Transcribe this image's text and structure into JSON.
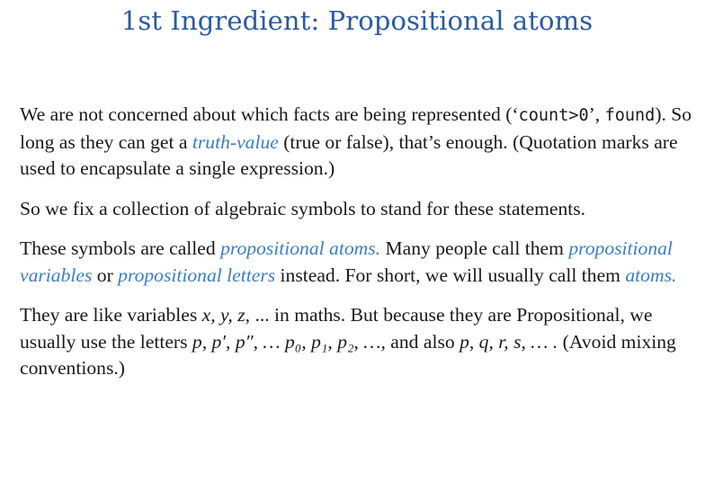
{
  "title": "1st Ingredient: Propositional atoms",
  "p1": {
    "a": "We are not concerned about which facts are being represented (‘",
    "code1": "count>0",
    "b": "’, ",
    "code2": "found",
    "c": "). So long as they can get a ",
    "em": "truth-value",
    "d": " (true or false), that’s enough. (Quotation marks are used to encapsulate a single expression.)"
  },
  "p2": {
    "text": "So we fix a collection of algebraic symbols to stand for these statements."
  },
  "p3": {
    "a": "These symbols are called ",
    "em1": "propositional atoms.",
    "b": " Many people call them ",
    "em2": "propositional variables",
    "c": " or ",
    "em3": "propositional letters",
    "d": " instead. For short, we will usually call them ",
    "em4": "atoms."
  },
  "p4": {
    "a": "They are like variables ",
    "m1": "x, y, z",
    "b": ", ... in maths. But because they are Propositional, we usually use the letters ",
    "m2": "p, p′, p″, … p₀, p₁, p₂, …,",
    "c": " and also ",
    "m3": "p, q, r, s, … .",
    "d": " (Avoid mixing conventions.)"
  }
}
